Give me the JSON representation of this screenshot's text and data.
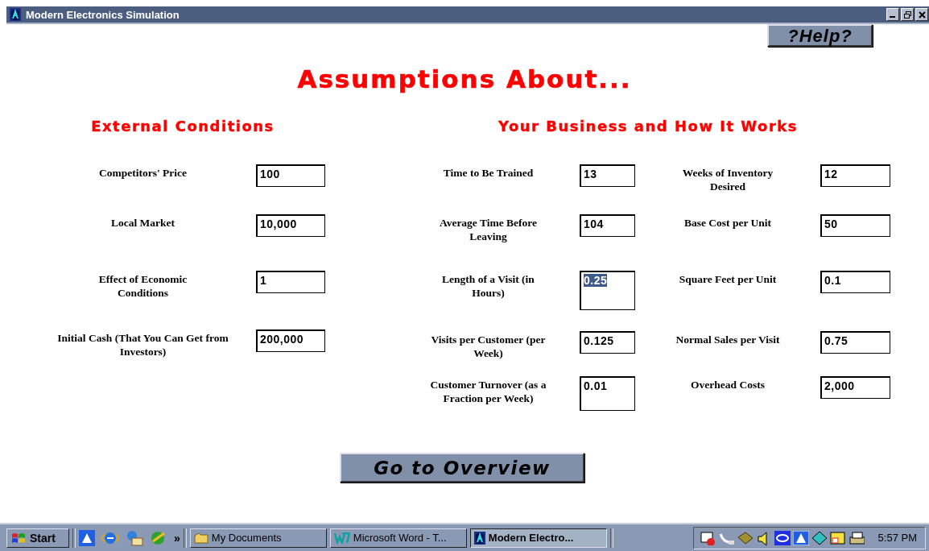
{
  "window": {
    "title": "Modern Electronics Simulation"
  },
  "help_button": {
    "label": "?Help?"
  },
  "heading": "Assumptions About...",
  "sections": [
    {
      "title": "External Conditions",
      "columns": [
        [
          {
            "label": "Competitors' Price",
            "value": "100",
            "selected": false
          },
          {
            "label": "Local Market",
            "value": "10,000",
            "selected": false
          },
          {
            "label": "Effect of Economic Conditions",
            "value": "1",
            "selected": false
          },
          {
            "label": "Initial Cash (That You Can Get from Investors)",
            "value": "200,000",
            "selected": false
          }
        ]
      ]
    },
    {
      "title": "Your Business and How It Works",
      "columns": [
        [
          {
            "label": "Time to Be Trained",
            "value": "13",
            "selected": false
          },
          {
            "label": "Average Time Before Leaving",
            "value": "104",
            "selected": false
          },
          {
            "label": "Length of a Visit (in Hours)",
            "value": "0.25",
            "selected": true
          },
          {
            "label": "Visits per Customer (per Week)",
            "value": "0.125",
            "selected": false
          },
          {
            "label": "Customer Turnover (as a Fraction per Week)",
            "value": "0.01",
            "selected": false
          }
        ],
        [
          {
            "label": "Weeks of Inventory Desired",
            "value": "12",
            "selected": false
          },
          {
            "label": "Base Cost per Unit",
            "value": "50",
            "selected": false
          },
          {
            "label": "Square Feet per Unit",
            "value": "0.1",
            "selected": false
          },
          {
            "label": "Normal Sales per Visit",
            "value": "0.75",
            "selected": false
          },
          {
            "label": "Overhead Costs",
            "value": "2,000",
            "selected": false
          }
        ]
      ]
    }
  ],
  "overview_button": {
    "label": "Go to Overview"
  },
  "taskbar": {
    "start": "Start",
    "more": "»",
    "tasks": [
      {
        "label": "My Documents",
        "kind": "folder",
        "selected": false
      },
      {
        "label": "Microsoft Word - T...",
        "kind": "word",
        "selected": false
      },
      {
        "label": "Modern Electro...",
        "kind": "app",
        "selected": true
      }
    ],
    "clock": "5:57 PM"
  }
}
